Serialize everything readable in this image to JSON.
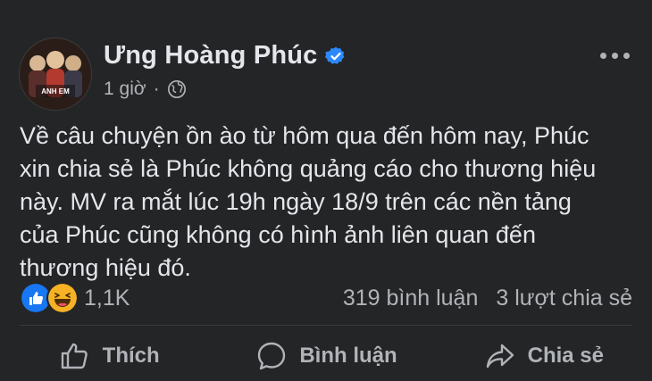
{
  "post": {
    "author": "Ưng Hoàng Phúc",
    "timestamp": "1 giờ",
    "separator": "·",
    "privacy_icon": "globe-icon",
    "text": "Về câu chuyện ồn ào từ hôm qua đến hôm nay, Phúc\nxin chia sẻ là Phúc không quảng cáo cho thương hiệu\nnày. MV ra mắt lúc 19h ngày 18/9 trên các nền tảng\ncủa Phúc cũng không có hình ảnh liên quan đến\nthương hiệu đó."
  },
  "avatar": {
    "overlay_text": "ANH EM"
  },
  "reactions": {
    "types": [
      "like",
      "haha"
    ],
    "count": "1,1K"
  },
  "stats": {
    "comments": "319 bình luận",
    "shares": "3 lượt chia sẻ"
  },
  "actions": {
    "like": "Thích",
    "comment": "Bình luận",
    "share": "Chia sẻ"
  },
  "colors": {
    "background": "#242526",
    "text": "#e4e6eb",
    "secondary": "#b0b3b8",
    "verified": "#2d88ff",
    "like": "#1877f2",
    "haha": "#f7b125"
  }
}
